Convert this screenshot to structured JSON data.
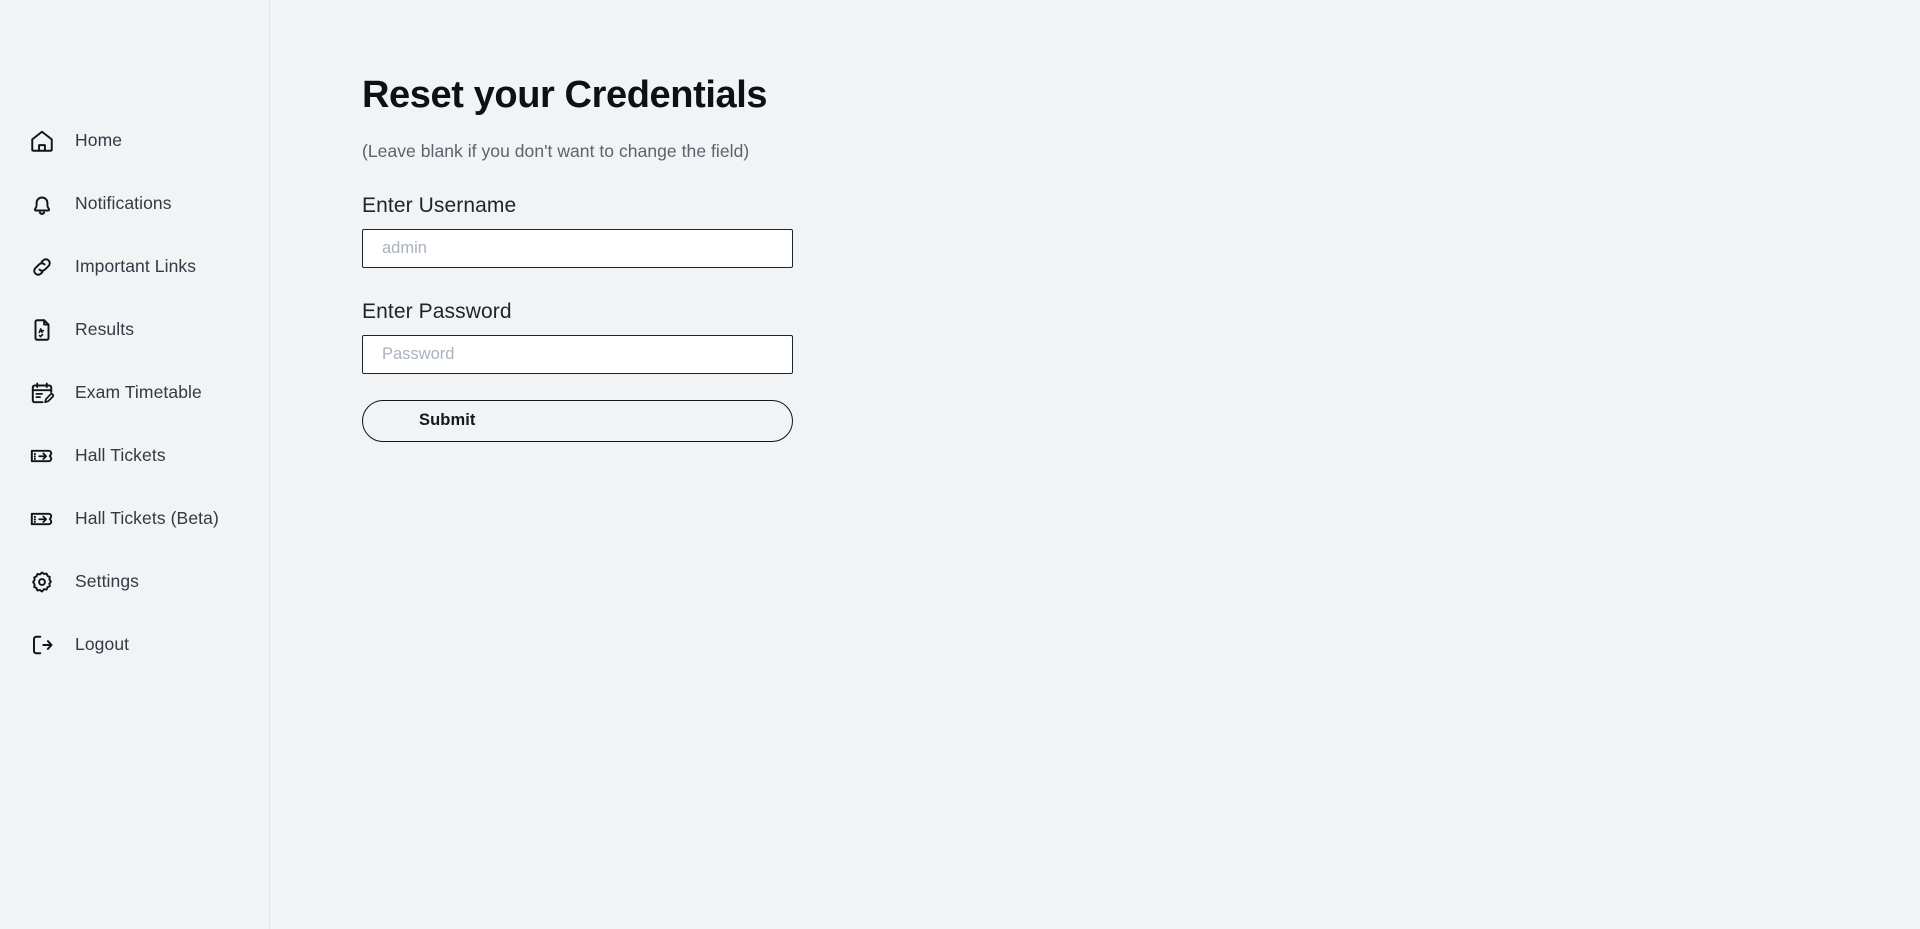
{
  "sidebar": {
    "items": [
      {
        "label": "Home",
        "icon": "home-icon"
      },
      {
        "label": "Notifications",
        "icon": "bell-icon"
      },
      {
        "label": "Important Links",
        "icon": "link-icon"
      },
      {
        "label": "Results",
        "icon": "document-grade-icon"
      },
      {
        "label": "Exam Timetable",
        "icon": "calendar-edit-icon"
      },
      {
        "label": "Hall Tickets",
        "icon": "ticket-icon"
      },
      {
        "label": "Hall Tickets (Beta)",
        "icon": "ticket-icon"
      },
      {
        "label": "Settings",
        "icon": "gear-icon"
      },
      {
        "label": "Logout",
        "icon": "logout-icon"
      }
    ]
  },
  "main": {
    "title": "Reset your Credentials",
    "subtitle": "(Leave blank if you don't want to change the field)",
    "username": {
      "label": "Enter Username",
      "placeholder": "admin",
      "value": ""
    },
    "password": {
      "label": "Enter Password",
      "placeholder": "Password",
      "value": ""
    },
    "submit_label": "Submit"
  },
  "colors": {
    "background": "#f1f3f5",
    "divider": "#dfe3e8",
    "text_primary": "#1c242c",
    "text_muted": "#5a636e",
    "input_border": "#1b232c",
    "input_background": "#ffffff",
    "placeholder": "#a9b2bd"
  }
}
